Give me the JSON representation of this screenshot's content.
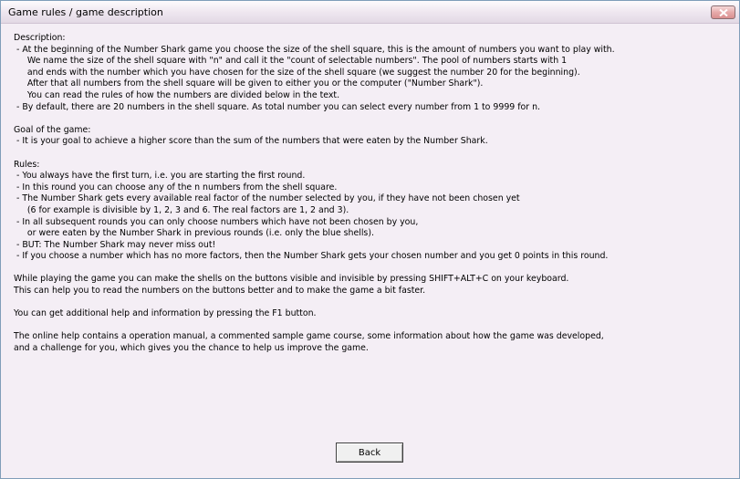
{
  "window": {
    "title": "Game rules  / game description",
    "close_icon": "close-icon"
  },
  "content_lines": [
    "Description:",
    " - At the beginning of the Number Shark game you choose the size of the shell square, this is the amount of numbers you want to play with.",
    "     We name the size of the shell square with \"n\" and call it the \"count of selectable numbers\". The pool of numbers starts with 1",
    "     and ends with the number which you have chosen for the size of the shell square (we suggest the number 20 for the beginning).",
    "     After that all numbers from the shell square will be given to either you or the computer (\"Number Shark\").",
    "     You can read the rules of how the numbers are divided below in the text.",
    " - By default, there are 20 numbers in the shell square. As total number you can select every number from 1 to 9999 for n.",
    "",
    "Goal of the game:",
    " - It is your goal to achieve a higher score than the sum of the numbers that were eaten by the Number Shark.",
    "",
    "Rules:",
    " - You always have the first turn, i.e. you are starting the first round.",
    " - In this round you can choose any of the n numbers from the shell square.",
    " - The Number Shark gets every available real factor of the number selected by you, if they have not been chosen yet",
    "     (6 for example is divisible by 1, 2, 3 and 6. The real factors are 1, 2 and 3).",
    " - In all subsequent rounds you can only choose numbers which have not been chosen by you,",
    "     or were eaten by the Number Shark in previous rounds (i.e. only the blue shells).",
    " - BUT: The Number Shark may never miss out!",
    " - If you choose a number which has no more factors, then the Number Shark gets your chosen number and you get 0 points in this round.",
    "",
    "While playing the game you can make the shells on the buttons visible and invisible by pressing SHIFT+ALT+C on your keyboard.",
    "This can help you to read the numbers on the buttons better and to make the game a bit faster.",
    "",
    "You can get additional help and information by pressing the F1 button.",
    "",
    "The online help contains a operation manual, a commented sample game course, some information about how the game was developed,",
    "and a challenge for you, which gives you the chance to help us improve the game."
  ],
  "buttons": {
    "back_label": "Back"
  }
}
